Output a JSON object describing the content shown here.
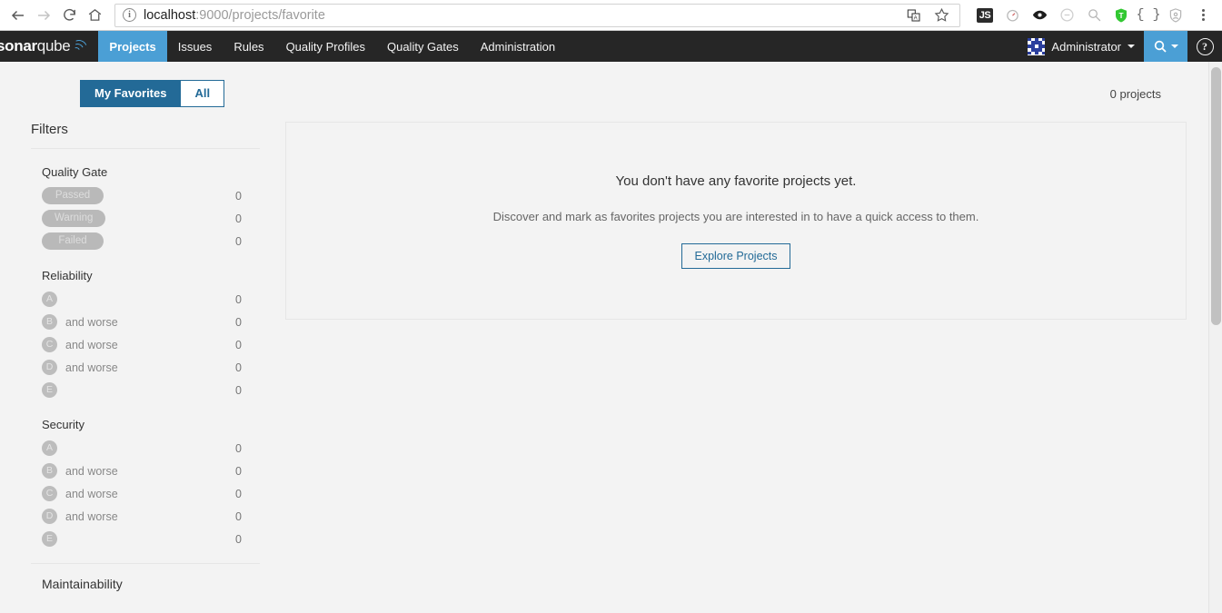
{
  "browser": {
    "back_icon": "back-arrow-icon",
    "forward_icon": "forward-arrow-icon",
    "reload_icon": "reload-icon",
    "home_icon": "home-icon",
    "url_host": "localhost",
    "url_path": ":9000/projects/favorite",
    "url_full": "localhost:9000/projects/favorite",
    "site_info_icon": "site-info-icon",
    "translate_icon": "translate-icon",
    "bookmark_icon": "star-icon",
    "extensions": [
      {
        "name": "js-extension-icon",
        "label": "JS"
      },
      {
        "name": "timer-extension-icon",
        "label": ""
      },
      {
        "name": "eye-extension-icon",
        "label": ""
      },
      {
        "name": "circle-extension-icon",
        "label": ""
      },
      {
        "name": "magnifier-extension-icon",
        "label": ""
      },
      {
        "name": "shield-green-extension-icon",
        "label": "T"
      },
      {
        "name": "braces-extension-icon",
        "label": "{ }"
      },
      {
        "name": "shield-grey-extension-icon",
        "label": ""
      }
    ],
    "menu_icon": "chrome-menu-icon"
  },
  "navbar": {
    "logo_bold": "sonar",
    "logo_light": "qube",
    "menu": [
      {
        "label": "Projects",
        "active": true
      },
      {
        "label": "Issues",
        "active": false
      },
      {
        "label": "Rules",
        "active": false
      },
      {
        "label": "Quality Profiles",
        "active": false
      },
      {
        "label": "Quality Gates",
        "active": false
      },
      {
        "label": "Administration",
        "active": false
      }
    ],
    "user_name": "Administrator",
    "search_icon": "search-icon",
    "help_icon": "help-icon",
    "active_color": "#4b9fd5",
    "bg_color": "#262626"
  },
  "toolbar": {
    "my_favorites_label": "My Favorites",
    "all_label": "All",
    "projects_count": "0 projects"
  },
  "sidebar": {
    "title": "Filters",
    "facets": [
      {
        "name": "quality-gate",
        "title": "Quality Gate",
        "type": "pill",
        "rows": [
          {
            "label": "Passed",
            "count": "0"
          },
          {
            "label": "Warning",
            "count": "0"
          },
          {
            "label": "Failed",
            "count": "0"
          }
        ]
      },
      {
        "name": "reliability",
        "title": "Reliability",
        "type": "rating",
        "rows": [
          {
            "label": "A",
            "suffix": "",
            "count": "0"
          },
          {
            "label": "B",
            "suffix": "and worse",
            "count": "0"
          },
          {
            "label": "C",
            "suffix": "and worse",
            "count": "0"
          },
          {
            "label": "D",
            "suffix": "and worse",
            "count": "0"
          },
          {
            "label": "E",
            "suffix": "",
            "count": "0"
          }
        ]
      },
      {
        "name": "security",
        "title": "Security",
        "type": "rating",
        "rows": [
          {
            "label": "A",
            "suffix": "",
            "count": "0"
          },
          {
            "label": "B",
            "suffix": "and worse",
            "count": "0"
          },
          {
            "label": "C",
            "suffix": "and worse",
            "count": "0"
          },
          {
            "label": "D",
            "suffix": "and worse",
            "count": "0"
          },
          {
            "label": "E",
            "suffix": "",
            "count": "0"
          }
        ]
      },
      {
        "name": "maintainability",
        "title": "Maintainability",
        "type": "rating",
        "rows": []
      }
    ]
  },
  "main": {
    "empty_title": "You don't have any favorite projects yet.",
    "empty_subtitle": "Discover and mark as favorites projects you are interested in to have a quick access to them.",
    "explore_button": "Explore Projects"
  },
  "colors": {
    "accent_blue": "#4b9fd5",
    "dark_blue": "#236a97",
    "navbar_bg": "#262626",
    "page_bg": "#f3f3f3"
  }
}
